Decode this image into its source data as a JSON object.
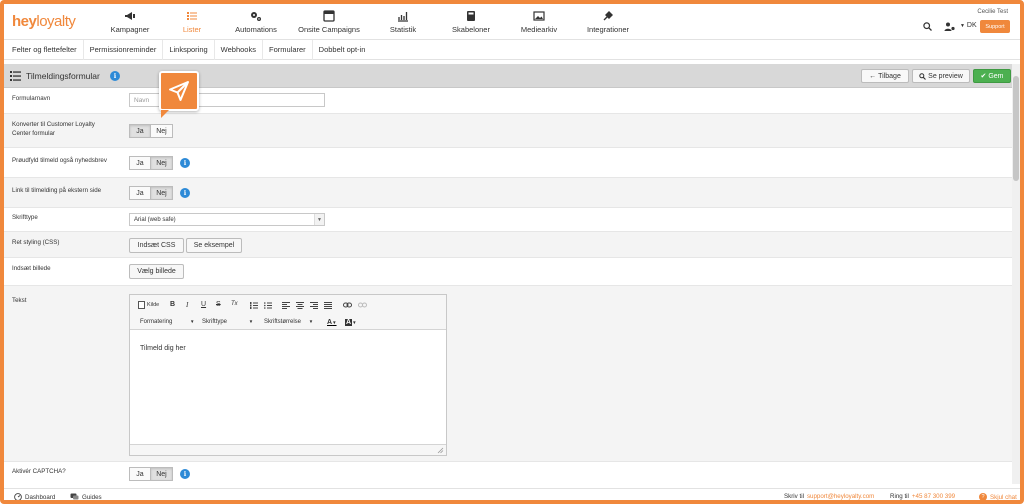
{
  "brand": {
    "logo_hey": "hey",
    "logo_loyalty": "loyalty",
    "accent": "#f0883c",
    "info": "#2d8ad7",
    "success": "#4cb050"
  },
  "nav": {
    "items": [
      {
        "label": "Kampagner",
        "icon": "megaphone-icon"
      },
      {
        "label": "Lister",
        "icon": "list-icon"
      },
      {
        "label": "Automations",
        "icon": "gears-icon"
      },
      {
        "label": "Onsite Campaigns",
        "icon": "window-icon"
      },
      {
        "label": "Statistik",
        "icon": "chart-icon"
      },
      {
        "label": "Skabeloner",
        "icon": "template-icon"
      },
      {
        "label": "Mediearkiv",
        "icon": "image-icon"
      },
      {
        "label": "Integrationer",
        "icon": "plug-icon"
      }
    ],
    "user_name": "Cecilie Test",
    "language": "DK",
    "support_label": "Support"
  },
  "subnav": [
    "Felter og flettefelter",
    "Permissionreminder",
    "Linksporing",
    "Webhooks",
    "Formularer",
    "Dobbelt opt-in"
  ],
  "toolbar": {
    "title": "Tilmeldingsformular",
    "info": "i",
    "back_label": "Tilbage",
    "preview_label": "Se preview",
    "save_label": "Gem"
  },
  "form": {
    "name_label": "Formularnavn",
    "name_placeholder": "Navn",
    "convert_label": "Konverter til Customer Loyalty Center formular",
    "prefill_label": "Prøudfyld tilmeld også nyhedsbrev",
    "link_label": "Link til tilmelding på ekstern side",
    "font_label": "Skrifttype",
    "font_value": "Arial (web safe)",
    "css_label": "Ret styling (CSS)",
    "css_insert": "Indsæt CSS",
    "css_example": "Se eksempel",
    "image_label": "Indsæt billede",
    "image_choose": "Vælg billede",
    "text_label": "Tekst",
    "captcha_label": "Aktivér CAPTCHA?",
    "yes": "Ja",
    "no": "Nej"
  },
  "editor": {
    "source": "Kilde",
    "bold": "B",
    "italic": "I",
    "underline": "U",
    "strike": "S",
    "clear": "Tx",
    "format": "Formatering",
    "font": "Skrifttype",
    "size": "Skriftstørrelse",
    "text_color": "A",
    "bg_color": "A",
    "content": "Tilmeld dig her"
  },
  "footer": {
    "dashboard": "Dashboard",
    "guides": "Guides",
    "write_to": "Skriv til",
    "email": "support@heyloyalty.com",
    "call": "Ring til",
    "phone": "+45 87 300 399",
    "hide_chat": "Skjul chat"
  }
}
